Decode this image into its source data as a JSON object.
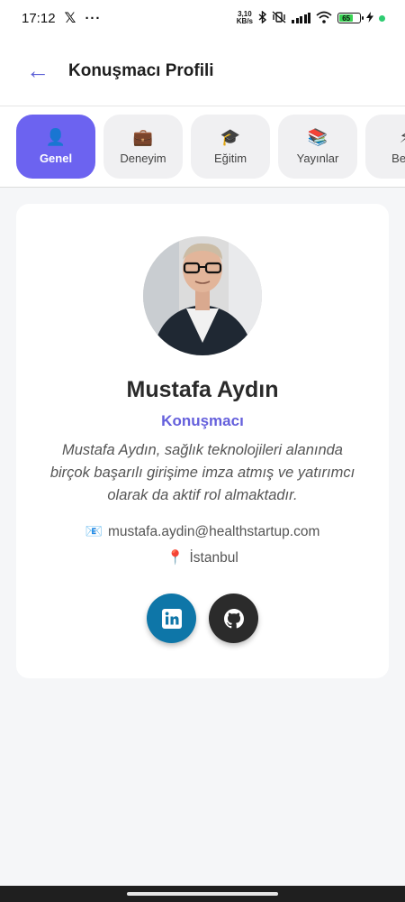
{
  "status_bar": {
    "time": "17:12",
    "x_logo": "𝕏",
    "more": "···",
    "net_speed_value": "3,10",
    "net_speed_unit": "KB/s",
    "battery": "65"
  },
  "header": {
    "back_icon": "←",
    "title": "Konuşmacı Profili"
  },
  "tabs": [
    {
      "icon": "👤",
      "label": "Genel",
      "active": true
    },
    {
      "icon": "💼",
      "label": "Deneyim",
      "active": false
    },
    {
      "icon": "🎓",
      "label": "Eğitim",
      "active": false
    },
    {
      "icon": "📚",
      "label": "Yayınlar",
      "active": false
    },
    {
      "icon": "⚡",
      "label": "Bece",
      "active": false
    }
  ],
  "profile": {
    "name": "Mustafa Aydın",
    "role": "Konuşmacı",
    "bio": "Mustafa Aydın, sağlık teknolojileri alanında birçok başarılı girişime imza atmış ve yatırımcı olarak da aktif rol almaktadır.",
    "email_icon": "📧",
    "email": "mustafa.aydin@healthstartup.com",
    "location_icon": "📍",
    "location": "İstanbul"
  },
  "social": {
    "linkedin_icon": "linkedin-icon",
    "github_icon": "github-icon"
  },
  "colors": {
    "accent": "#6c63f0",
    "role_text": "#6560dc",
    "linkedin": "#0e76a8",
    "github": "#2b2b2b"
  }
}
